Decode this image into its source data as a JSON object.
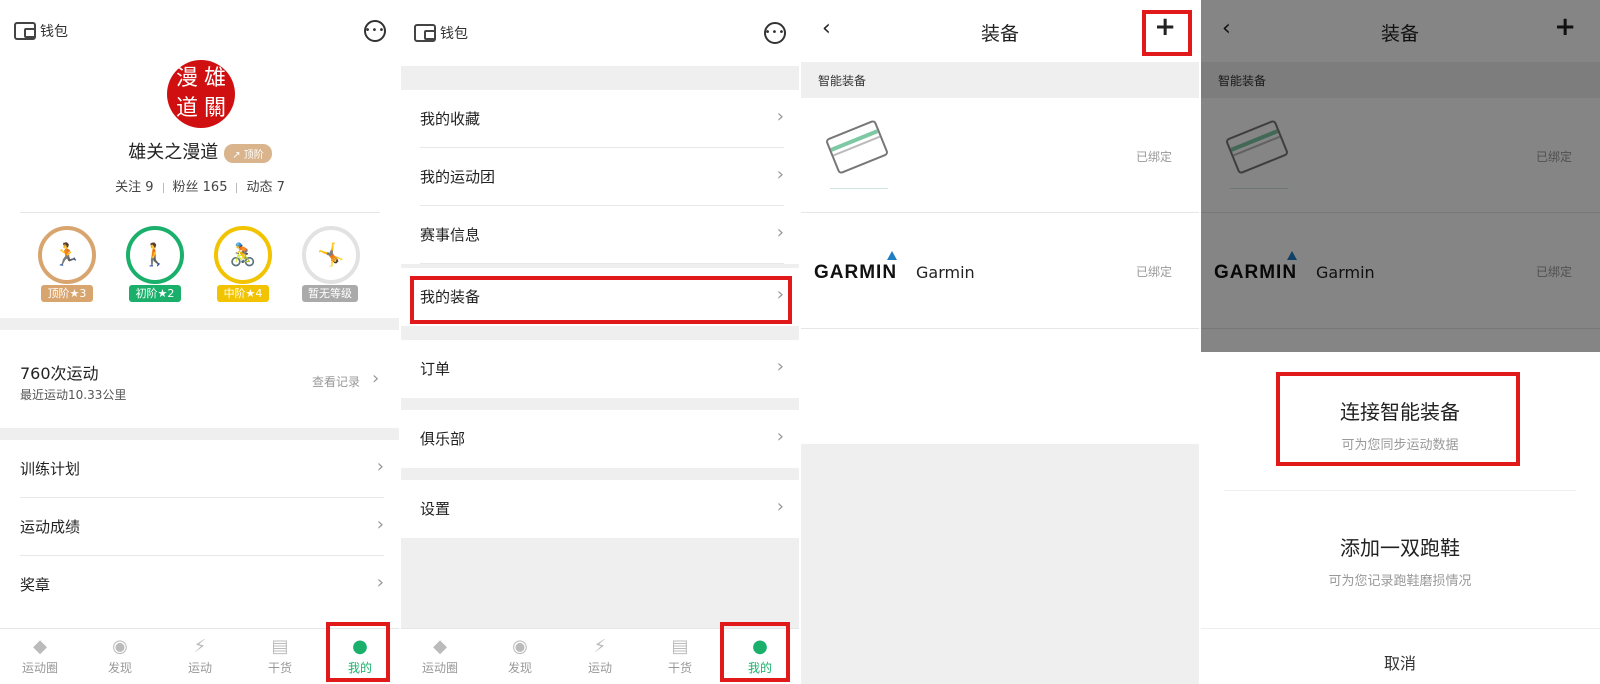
{
  "common": {
    "wallet_label": "钱包",
    "tabs": [
      {
        "label": "运动圈",
        "icon": "sport-circle-icon"
      },
      {
        "label": "发现",
        "icon": "discover-icon"
      },
      {
        "label": "运动",
        "icon": "shoe-icon"
      },
      {
        "label": "干货",
        "icon": "document-icon"
      },
      {
        "label": "我的",
        "icon": "person-icon"
      }
    ],
    "active_tab_color": "#1ab06b",
    "highlight_color": "#e2191b"
  },
  "profile": {
    "avatar_chars": [
      "漫",
      "雄",
      "道",
      "關"
    ],
    "name": "雄关之漫道",
    "name_badge": "↗ 顶阶",
    "stats": {
      "follow": "关注 9",
      "fans": "粉丝 165",
      "posts": "动态 7"
    },
    "levels": [
      {
        "label": "顶阶★3",
        "icon": "run-icon",
        "color": "#d9a56f",
        "glyph": "🏃"
      },
      {
        "label": "初阶★2",
        "icon": "walk-icon",
        "color": "#1ab06b",
        "glyph": "🚶"
      },
      {
        "label": "中阶★4",
        "icon": "bike-icon",
        "color": "#f2c300",
        "glyph": "🚴"
      },
      {
        "label": "暂无等级",
        "icon": "fitness-icon",
        "color": "#aaaaaa",
        "glyph": "🤸"
      }
    ],
    "workouts": {
      "count": "760次运动",
      "recent": "最近运动10.33公里",
      "view": "查看记录"
    },
    "menu": [
      "训练计划",
      "运动成绩",
      "奖章"
    ]
  },
  "me_menu": {
    "items": [
      "我的收藏",
      "我的运动团",
      "赛事信息",
      "我的装备",
      "订单",
      "俱乐部",
      "设置"
    ]
  },
  "equipment": {
    "title": "装备",
    "section": "智能装备",
    "devices": [
      {
        "name": "",
        "status": "已绑定"
      },
      {
        "brand": "GARMIN",
        "name": "Garmin",
        "status": "已绑定"
      }
    ]
  },
  "add_sheet": {
    "options": [
      {
        "title": "连接智能装备",
        "subtitle": "可为您同步运动数据"
      },
      {
        "title": "添加一双跑鞋",
        "subtitle": "可为您记录跑鞋磨损情况"
      }
    ],
    "cancel": "取消"
  }
}
